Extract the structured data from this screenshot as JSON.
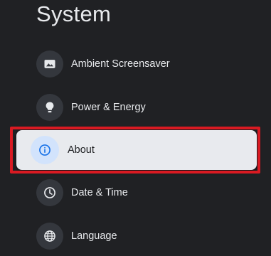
{
  "page": {
    "title": "System"
  },
  "menu": {
    "items": [
      {
        "label": "Ambient Screensaver",
        "icon": "screensaver-icon"
      },
      {
        "label": "Power & Energy",
        "icon": "lightbulb-icon"
      },
      {
        "label": "About",
        "icon": "info-icon",
        "selected": true
      },
      {
        "label": "Date & Time",
        "icon": "clock-icon"
      },
      {
        "label": "Language",
        "icon": "globe-icon"
      }
    ]
  },
  "colors": {
    "background": "#202124",
    "text": "#e8eaed",
    "selected_background": "#e8eaee",
    "selected_icon_background": "#d2e3fc",
    "selected_icon": "#1a73e8",
    "highlight_border": "#d91a22"
  }
}
